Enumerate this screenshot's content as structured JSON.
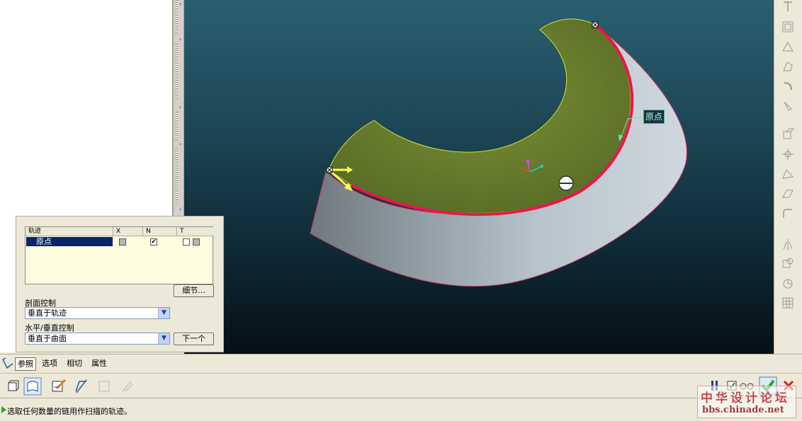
{
  "viewport": {
    "origin_label": "原点"
  },
  "panel": {
    "table": {
      "headers": [
        "轨迹",
        "X",
        "N",
        "T"
      ],
      "rows": [
        {
          "name": "原点",
          "x": "",
          "n": "✔",
          "t": ""
        }
      ]
    },
    "details_button": "细节...",
    "section_control_label": "剖面控制",
    "section_control_value": "垂直于轨迹",
    "hv_control_label": "水平/垂直控制",
    "hv_control_value": "垂直于曲面",
    "next_button": "下一个"
  },
  "tabs": [
    "参照",
    "选项",
    "相切",
    "属性"
  ],
  "active_tab": "参照",
  "status": {
    "message": "选取任何数量的链用作扫描的轨迹。"
  },
  "watermark": {
    "title": "中华设计论坛",
    "url": "bbs.chinade.net"
  },
  "colors": {
    "viewport_top": "#2a5f70",
    "viewport_bottom": "#050f16",
    "surface_green": "#627a2e",
    "surface_gray": "#a8b3bc",
    "trajectory_red": "#e8174a",
    "selection_blue": "#0a246a",
    "confirm_green": "#2aa52a",
    "cancel_red": "#d42020"
  }
}
